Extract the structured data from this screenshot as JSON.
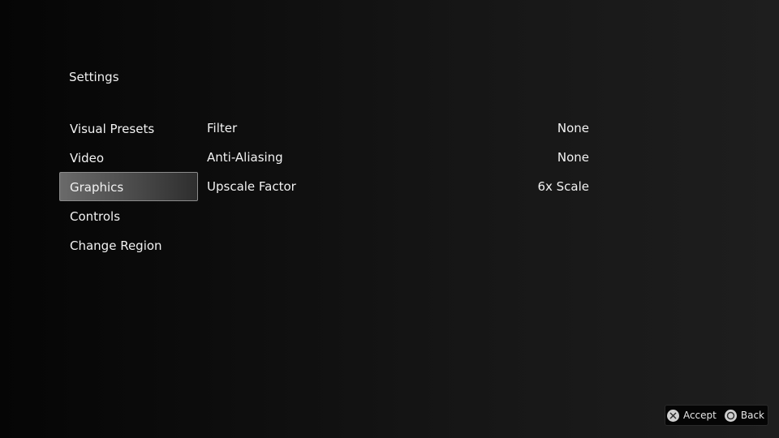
{
  "header": {
    "title": "Settings"
  },
  "menu": {
    "items": [
      {
        "label": "Visual Presets",
        "name": "menu-item-visual-presets",
        "selected": false
      },
      {
        "label": "Video",
        "name": "menu-item-video",
        "selected": false
      },
      {
        "label": "Graphics",
        "name": "menu-item-graphics",
        "selected": true
      },
      {
        "label": "Controls",
        "name": "menu-item-controls",
        "selected": false
      },
      {
        "label": "Change Region",
        "name": "menu-item-change-region",
        "selected": false
      }
    ]
  },
  "options": [
    {
      "label": "Filter",
      "value": "None"
    },
    {
      "label": "Anti-Aliasing",
      "value": "None"
    },
    {
      "label": "Upscale Factor",
      "value": "6x Scale"
    }
  ],
  "footer": {
    "accept": {
      "icon": "cross-button-icon",
      "label": "Accept"
    },
    "back": {
      "icon": "circle-button-icon",
      "label": "Back"
    }
  }
}
